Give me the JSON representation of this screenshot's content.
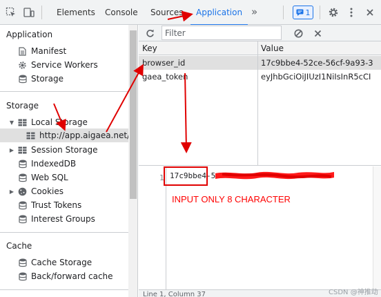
{
  "topbar": {
    "tabs": [
      {
        "label": "Elements"
      },
      {
        "label": "Console"
      },
      {
        "label": "Sources"
      },
      {
        "label": "Application",
        "active": true
      }
    ],
    "more_label": "»",
    "issues_count": "1"
  },
  "sidebar": {
    "application": {
      "title": "Application",
      "items": [
        "Manifest",
        "Service Workers",
        "Storage"
      ]
    },
    "storage": {
      "title": "Storage",
      "local_storage": "Local Storage",
      "local_origin": "http://app.aigaea.net/",
      "items": [
        "Session Storage",
        "IndexedDB",
        "Web SQL",
        "Cookies",
        "Trust Tokens",
        "Interest Groups"
      ]
    },
    "cache": {
      "title": "Cache",
      "items": [
        "Cache Storage",
        "Back/forward cache"
      ]
    }
  },
  "toolbar": {
    "filter_placeholder": "Filter"
  },
  "table": {
    "columns": [
      "Key",
      "Value"
    ],
    "rows": [
      {
        "key": "browser_id",
        "value": "17c9bbe4-52ce-56cf-9a93-3",
        "selected": true
      },
      {
        "key": "gaea_token",
        "value": "eyJhbGciOiJIUzI1NiIsInR5cCI",
        "selected": false
      }
    ]
  },
  "viewer": {
    "line_number": "1",
    "value_prefix": "17c9bbe4-5",
    "annotation": "INPUT ONLY 8 CHARACTER",
    "status": "Line 1, Column 37"
  },
  "watermark": "CSDN @神推动",
  "colors": {
    "accent": "#1a73e8",
    "annotation_red": "#ff0000"
  }
}
